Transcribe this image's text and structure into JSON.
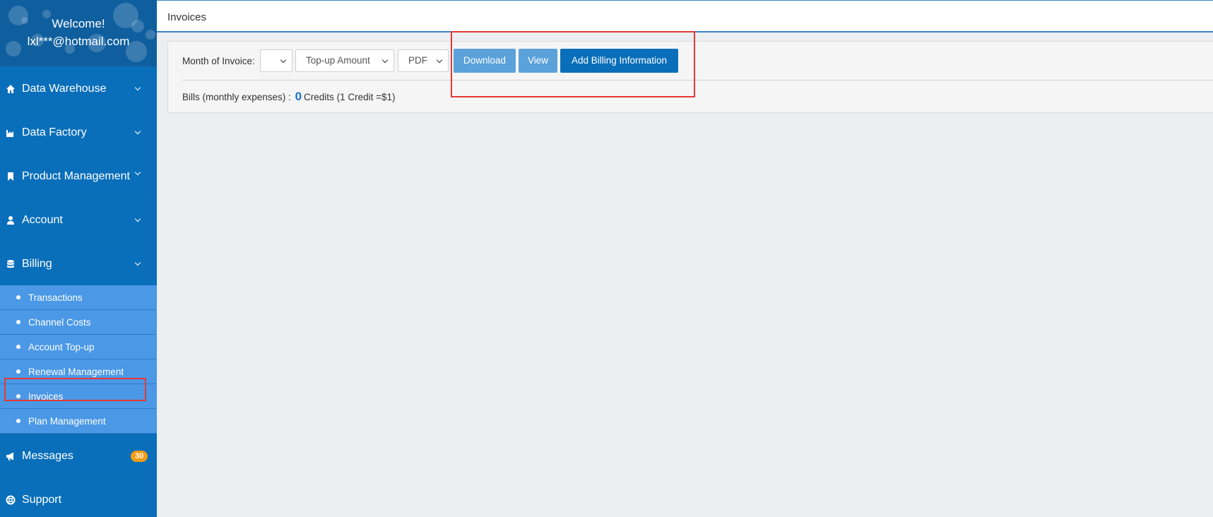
{
  "user": {
    "welcome": "Welcome!",
    "email": "lxl***@hotmail.com"
  },
  "sidebar": {
    "items": [
      {
        "label": "Data Warehouse",
        "icon": "home-icon"
      },
      {
        "label": "Data Factory",
        "icon": "factory-icon"
      },
      {
        "label": "Product Management",
        "icon": "bookmark-icon"
      },
      {
        "label": "Account",
        "icon": "user-icon"
      },
      {
        "label": "Billing",
        "icon": "database-icon",
        "expanded": true
      }
    ],
    "billing_sub": [
      {
        "label": "Transactions"
      },
      {
        "label": "Channel Costs"
      },
      {
        "label": "Account Top-up"
      },
      {
        "label": "Renewal Management"
      },
      {
        "label": "Invoices",
        "active": true
      },
      {
        "label": "Plan Management"
      }
    ],
    "messages": {
      "label": "Messages",
      "icon": "megaphone-icon",
      "badge": "30"
    },
    "support": {
      "label": "Support",
      "icon": "lifebuoy-icon"
    }
  },
  "header": {
    "title": "Invoices"
  },
  "filters": {
    "month_label": "Month of Invoice:",
    "month_value": "",
    "type_value": "Top-up Amount",
    "format_value": "PDF",
    "download_label": "Download",
    "view_label": "View",
    "add_billing_label": "Add Billing Information"
  },
  "bills": {
    "label": "Bills (monthly expenses) :",
    "amount": "0",
    "unit": "Credits",
    "note": "(1 Credit =$1)"
  },
  "colors": {
    "sidebar": "#0a6fba",
    "submenu": "#4a98e6",
    "badge": "#f39c12",
    "highlight": "#e53935"
  }
}
